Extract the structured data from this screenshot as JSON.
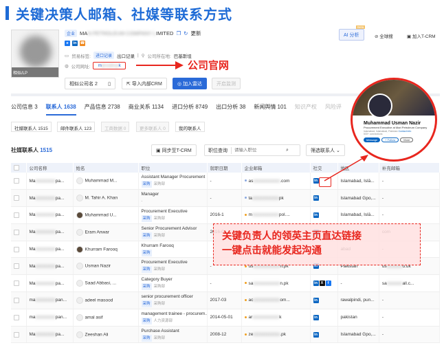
{
  "banner": {
    "title": "关键决策人邮箱、社媒等联系方式"
  },
  "company": {
    "logo_label": "相似/LP",
    "type_tag": "企业",
    "name_start": "MA",
    "name_blur": "N PETROLEUM COMPANY L",
    "name_end": "IMITED",
    "refresh": "更新",
    "trade_label": "贸易标签:",
    "import_record": "进口记录",
    "export_record": "出口记录",
    "location_label": "公司所在地:",
    "location": "巴基斯坦",
    "website_label": "公司网址:",
    "website_start": "m",
    "website_blur": "pl.com.p",
    "website_end": "k",
    "website_callout": "公司官网"
  },
  "header_actions": {
    "ai": "AI 分析",
    "beta": "Beta",
    "global": "全球搜",
    "add_tcrm": "加入T-CRM"
  },
  "actions": {
    "similar": "相似公司名 2",
    "import_crm": "导入内部CRM",
    "add_radar": "加入雷达",
    "monitor": "开启监测"
  },
  "tabs": [
    {
      "label": "公司信息 3"
    },
    {
      "label": "联系人 1638",
      "active": true
    },
    {
      "label": "产品信息 2738"
    },
    {
      "label": "商业关系 1134"
    },
    {
      "label": "进口分析 8749"
    },
    {
      "label": "出口分析 38"
    },
    {
      "label": "新闻舆情 101"
    },
    {
      "label": "知识产权",
      "disabled": true
    },
    {
      "label": "风险评",
      "disabled": true
    }
  ],
  "subtabs": [
    {
      "label": "社媒联系人 1515"
    },
    {
      "label": "邮件联系人 123"
    },
    {
      "label": "工商数据 0",
      "disabled": true
    },
    {
      "label": "更多联系人 0",
      "disabled": true
    },
    {
      "label": "我的联系人"
    }
  ],
  "section": {
    "title": "社媒联系人",
    "count": "1515",
    "sync": "同步至T-CRM",
    "position_query": "职位查询",
    "position_placeholder": "请输入职位",
    "filter": "筛选联系人"
  },
  "table": {
    "columns": [
      "公司名称",
      "姓名",
      "职位",
      "就职日期",
      "企业邮箱",
      "社交",
      "地区",
      "补充邮箱"
    ],
    "rows": [
      {
        "company": "Ma",
        "company_end": "pa...",
        "name": "Muhammad M...",
        "position": "Assistant Manager Procurement",
        "tag": "采购",
        "dept": "采购部",
        "date": "-",
        "email": "as",
        "email_end": ".com",
        "social": [
          "in"
        ],
        "region": "Islamabad, Islā...",
        "extra": "-"
      },
      {
        "company": "Ma",
        "company_end": "pa...",
        "name": "M. Tahir A. Khan",
        "position": "Manager",
        "tag": "",
        "dept": "-",
        "date": "-",
        "email": "ta",
        "email_end": "pk",
        "social": [
          "in"
        ],
        "region": "Islamabad Gpo,...",
        "extra": "-"
      },
      {
        "company": "Ma",
        "company_end": "pa...",
        "name": "Muhammad U...",
        "photo": true,
        "position": "Procurement Executive",
        "tag": "采购",
        "dept": "采购部",
        "date": "2016-1",
        "email": "m",
        "email_end": "pol....",
        "social": [
          "in"
        ],
        "region": "Islamabad, Islā...",
        "extra": "-"
      },
      {
        "company": "Ma",
        "company_end": "pa...",
        "name": "Eram Anwar",
        "position": "Senior Procurement Advisor",
        "tag": "采购",
        "dept": "采购部",
        "date": "2016-0",
        "email": "",
        "email_end": "",
        "social": [
          "in"
        ],
        "region": "",
        "extra": "com"
      },
      {
        "company": "Ma",
        "company_end": "pa...",
        "name": "Khurram Farooq",
        "photo": true,
        "position": "Khurram Farooq",
        "tag": "采购",
        "dept": "",
        "date": "",
        "email": "k",
        "email_end": "",
        "social": [],
        "region": "abad",
        "extra": "-"
      },
      {
        "company": "Ma",
        "company_end": "pa...",
        "name": "Usman Nazir",
        "position": "Procurement Executive",
        "tag": "采购",
        "dept": "采购部",
        "date": "-",
        "email": "us",
        "email_end": "n.pk",
        "social": [
          "in"
        ],
        "region": "Pakistan",
        "extra": "us",
        "extra_end": "o.uk"
      },
      {
        "company": "Ma",
        "company_end": "pa...",
        "name": "Saad Abbasi, ...",
        "position": "Category Buyer",
        "tag": "采购",
        "dept": "采购部",
        "date": "-",
        "email": "sa",
        "email_end": "n.pk",
        "social": [
          "in",
          "x",
          "f"
        ],
        "region": "-",
        "extra": "sa",
        "extra_end": "all.c..."
      },
      {
        "company": "ma",
        "company_end": "pan...",
        "name": "adeel masood",
        "position": "senior procurement officer",
        "tag": "采购",
        "dept": "采购部",
        "date": "2017-03",
        "email": "ac",
        "email_end": "om...",
        "social": [
          "in"
        ],
        "region": "rawalpindi, pun...",
        "extra": "-"
      },
      {
        "company": "ma",
        "company_end": "pan...",
        "name": "amal asif",
        "position": "management trainee - procurem...",
        "tag": "采购",
        "dept": "人力资源部",
        "date": "2014-05-01",
        "email": "ar",
        "email_end": "k",
        "social": [
          "in"
        ],
        "region": "pakistan",
        "extra": "-"
      },
      {
        "company": "Ma",
        "company_end": "pa...",
        "name": "Zeeshan Ali",
        "position": "Purchase Assistant",
        "tag": "采购",
        "dept": "采购部",
        "date": "2008-12",
        "email": "ze",
        "email_end": ".pk",
        "social": [
          "in"
        ],
        "region": "Islamabad Gpo,...",
        "extra": "-"
      }
    ]
  },
  "profile_popup": {
    "name": "Muhammad Usman Nazir",
    "headline": "Procurement Executive at Mari Petroleum Company",
    "location": "Islamabad, Islamabad, Pakistan",
    "contact": "Contact info",
    "connections": "500+ connections",
    "message": "Message",
    "follow": "+ Follow",
    "more": "More"
  },
  "overlay": {
    "line1": "关键负责人的领英主页直达链接",
    "line2": "一键点击就能发起沟通"
  },
  "colors": {
    "brand": "#2a6ad8",
    "callout": "#e8261e",
    "linkedin": "#0a66c2"
  }
}
